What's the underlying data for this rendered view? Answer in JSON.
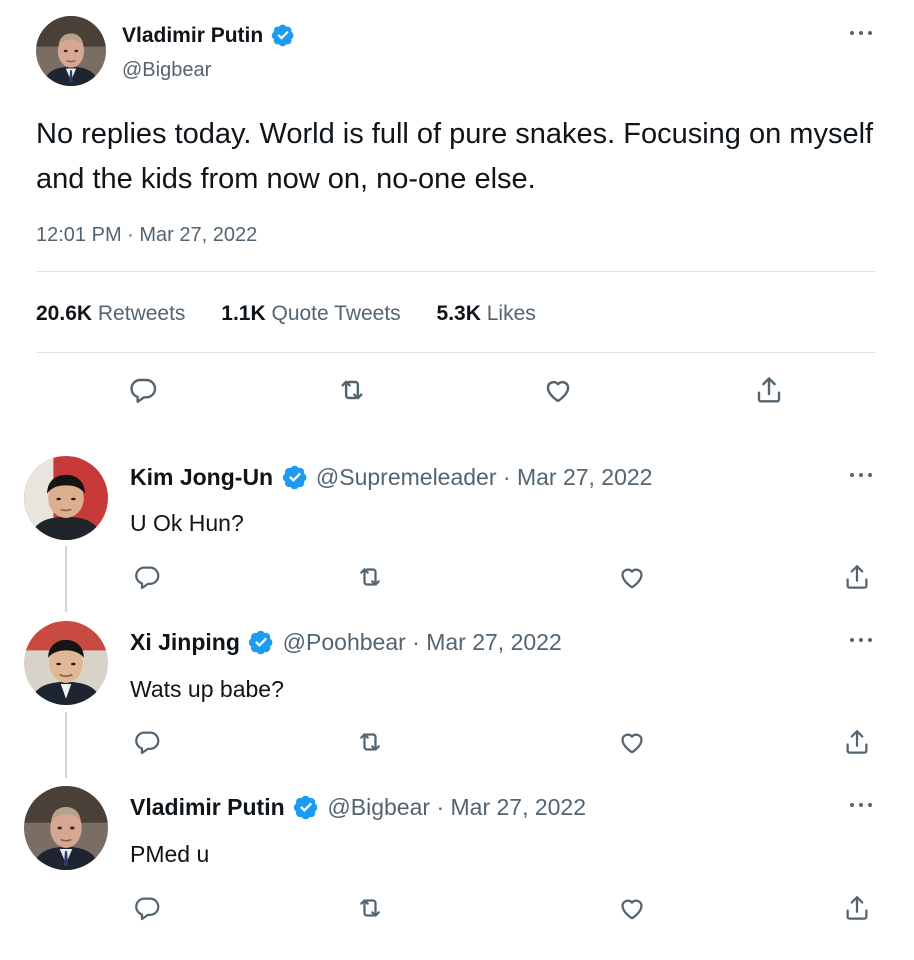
{
  "main_tweet": {
    "author": {
      "name": "Vladimir Putin",
      "handle": "@Bigbear",
      "avatar": "avatar-putin"
    },
    "text": "No replies today. World is full of pure snakes. Focusing on myself and the kids from now on, no-one else.",
    "timestamp": "12:01 PM · Mar 27, 2022",
    "stats": [
      {
        "value": "20.6K",
        "label": "Retweets"
      },
      {
        "value": "1.1K",
        "label": "Quote Tweets"
      },
      {
        "value": "5.3K",
        "label": "Likes"
      }
    ],
    "actions": [
      "reply-icon",
      "retweet-icon",
      "like-icon",
      "share-icon"
    ]
  },
  "replies": [
    {
      "name": "Kim Jong-Un",
      "handle": "@Supremeleader",
      "date": "· Mar 27, 2022",
      "text": "U Ok Hun?",
      "avatar": "avatar-kim"
    },
    {
      "name": "Xi Jinping",
      "handle": "@Poohbear",
      "date": "· Mar 27, 2022",
      "text": "Wats up babe?",
      "avatar": "avatar-xi"
    },
    {
      "name": "Vladimir Putin",
      "handle": "@Bigbear",
      "date": "· Mar 27, 2022",
      "text": "PMed u",
      "avatar": "avatar-putin"
    }
  ],
  "colors": {
    "verified": "#1d9bf0",
    "text": "#0f1419",
    "muted": "#536471",
    "divider": "#dfe3e6"
  }
}
